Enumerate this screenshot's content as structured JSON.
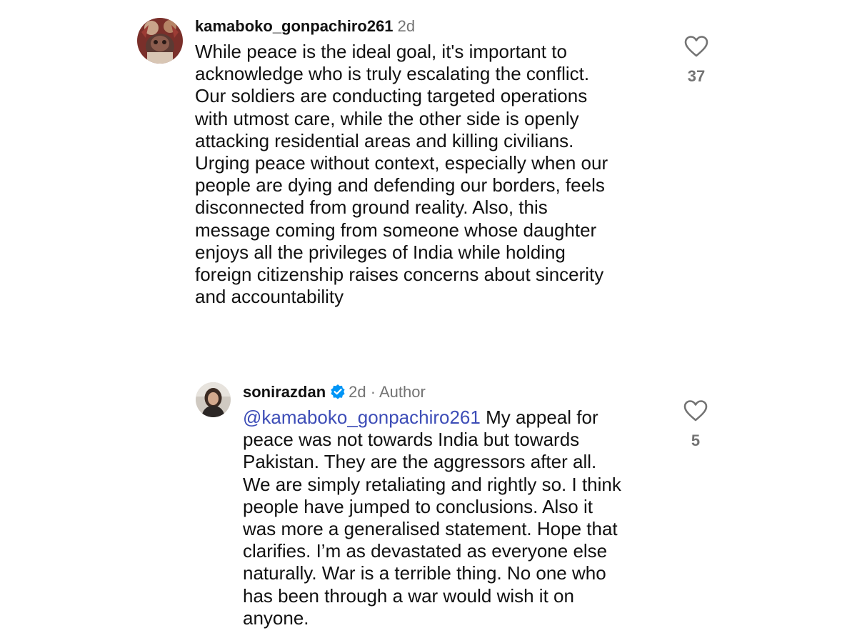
{
  "comments": [
    {
      "username": "kamaboko_gonpachiro261",
      "time": "2d",
      "lines": [
        "While peace is the ideal goal, it's important to",
        "acknowledge who is truly escalating the conflict.",
        "Our soldiers are conducting targeted operations",
        "with utmost care, while the other side is openly",
        "attacking residential areas and killing civilians.",
        "Urging peace without context, especially when our",
        "people are dying and defending our borders, feels",
        "disconnected from ground reality. Also, this",
        "message coming from someone whose daughter",
        "enjoys all the privileges of India while holding",
        "foreign citizenship raises concerns about sincerity",
        "and accountability"
      ],
      "like_count": "37",
      "like_icon": "heart-outline-icon"
    },
    {
      "username": "sonirazdan",
      "verified_icon": "verified-badge-icon",
      "time": "2d",
      "separator": "·",
      "author_label": "Author",
      "mention": "@kamaboko_gonpachiro261",
      "first_line_rest": " My appeal for",
      "lines": [
        "peace was not towards India but towards",
        "Pakistan. They are the aggressors after all.",
        "We are simply retaliating and rightly so. I think",
        "people have jumped to conclusions. Also it",
        "was more a generalised statement. Hope that",
        "clarifies. I’m as devastated as everyone else",
        "naturally. War is a terrible thing. No one who",
        "has been through a war would wish it on",
        "anyone."
      ],
      "like_count": "5",
      "like_icon": "heart-outline-icon"
    }
  ],
  "colors": {
    "text": "#111111",
    "secondary": "#737373",
    "mention": "#3d4db7",
    "verified": "#0095f6"
  }
}
